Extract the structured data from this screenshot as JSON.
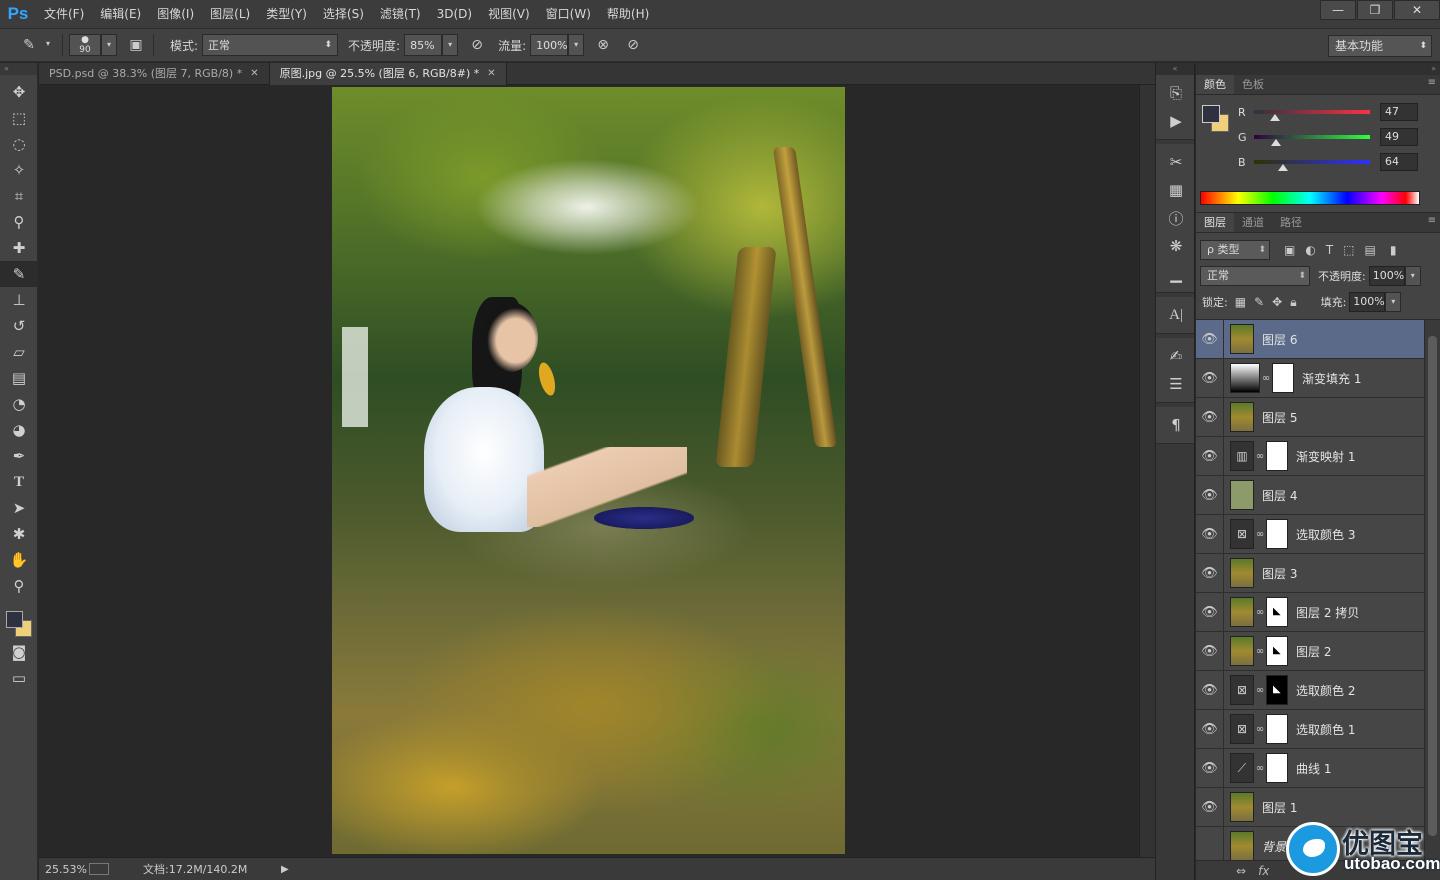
{
  "app": {
    "logo": "Ps",
    "menu": [
      "文件(F)",
      "编辑(E)",
      "图像(I)",
      "图层(L)",
      "类型(Y)",
      "选择(S)",
      "滤镜(T)",
      "3D(D)",
      "视图(V)",
      "窗口(W)",
      "帮助(H)"
    ],
    "window_controls": [
      "—",
      "❐",
      "✕"
    ]
  },
  "options": {
    "brush_size": "90",
    "mode_label": "模式:",
    "mode_value": "正常",
    "opacity_label": "不透明度:",
    "opacity_value": "85%",
    "flow_label": "流量:",
    "flow_value": "100%",
    "workspace": "基本功能"
  },
  "tabs": [
    {
      "label": "PSD.psd @ 38.3% (图层 7, RGB/8) *",
      "close": "✕"
    },
    {
      "label": "原图.jpg @ 25.5% (图层 6, RGB/8#) *",
      "close": "✕"
    }
  ],
  "status": {
    "zoom": "25.53%",
    "doc_size": "文档:17.2M/140.2M",
    "arrow": "▶"
  },
  "color_panel": {
    "tabs": [
      "颜色",
      "色板"
    ],
    "channels": [
      {
        "label": "R",
        "value": "47",
        "fraction": 0.184
      },
      {
        "label": "G",
        "value": "49",
        "fraction": 0.192
      },
      {
        "label": "B",
        "value": "64",
        "fraction": 0.251
      }
    ],
    "foreground_color": "#2f3140",
    "background_color": "#f0cf7a"
  },
  "layers_panel": {
    "tabs": [
      "图层",
      "通道",
      "路径"
    ],
    "filter_label": "ρ 类型",
    "blend_mode": "正常",
    "opacity_label": "不透明度:",
    "opacity_value": "100%",
    "lock_label": "锁定:",
    "fill_label": "填充:",
    "fill_value": "100%",
    "layers": [
      {
        "name": "图层 6",
        "thumb": "photo",
        "selected": true,
        "visible": true
      },
      {
        "name": "渐变填充 1",
        "thumb": "gradient",
        "mask": "white",
        "visible": true
      },
      {
        "name": "图层 5",
        "thumb": "photo",
        "visible": true
      },
      {
        "name": "渐变映射 1",
        "thumb": "adj",
        "mask": "white",
        "visible": true
      },
      {
        "name": "图层 4",
        "thumb": "olive",
        "visible": true
      },
      {
        "name": "选取颜色 3",
        "thumb": "adj",
        "mask": "white",
        "visible": true
      },
      {
        "name": "图层 3",
        "thumb": "photo",
        "visible": true
      },
      {
        "name": "图层 2 拷贝",
        "thumb": "photo",
        "mask": "white-mark",
        "visible": true
      },
      {
        "name": "图层 2",
        "thumb": "photo",
        "mask": "white-mark",
        "visible": true
      },
      {
        "name": "选取颜色 2",
        "thumb": "adj",
        "mask": "black-mark",
        "visible": true
      },
      {
        "name": "选取颜色 1",
        "thumb": "adj",
        "mask": "white",
        "visible": true
      },
      {
        "name": "曲线 1",
        "thumb": "adj",
        "mask": "white",
        "visible": true
      },
      {
        "name": "图层 1",
        "thumb": "photo",
        "visible": true
      },
      {
        "name": "背景",
        "thumb": "photo",
        "visible": false,
        "italic": true
      }
    ],
    "footer_icons": [
      "⇔",
      "fx"
    ]
  },
  "watermark": {
    "cn": "优图宝",
    "url": "utobao.com"
  }
}
